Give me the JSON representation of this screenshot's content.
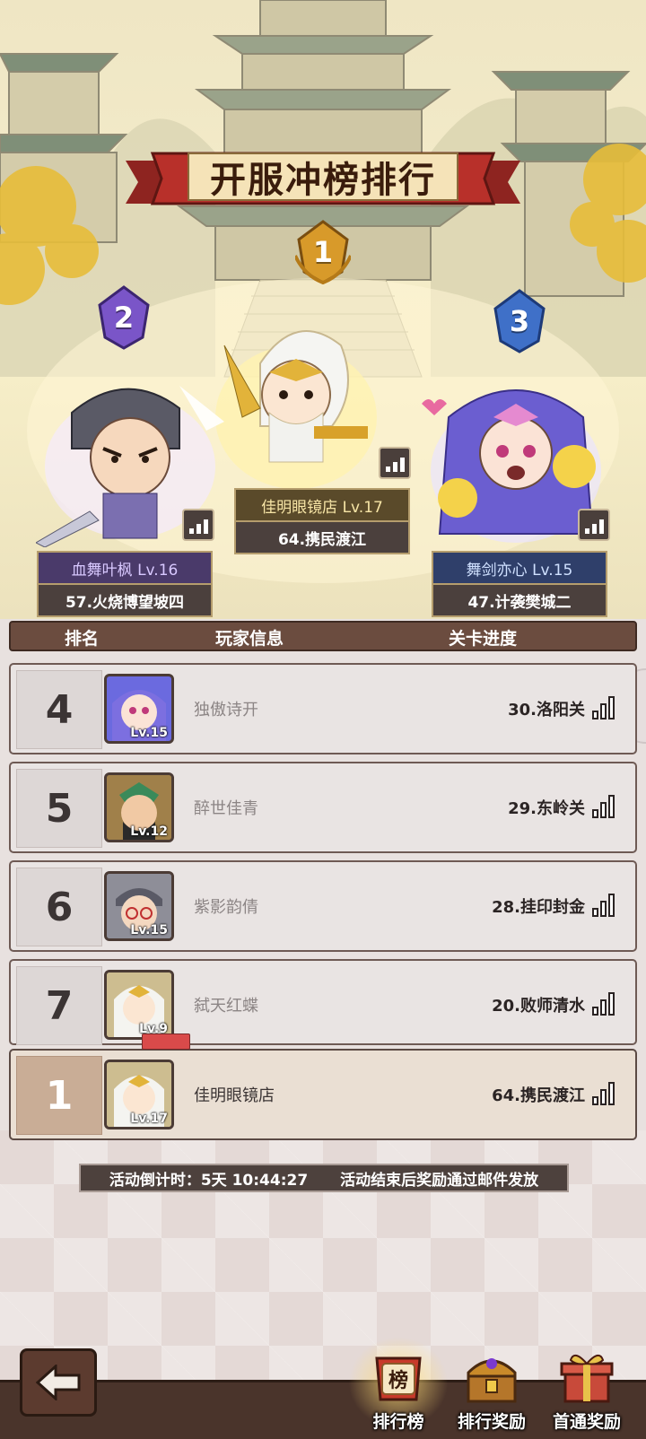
{
  "title": "开服冲榜排行",
  "podium": [
    {
      "rank": "1",
      "name": "佳明眼镜店 Lv.17",
      "stage": "64.携民渡江",
      "badge_color": "#d89a2a"
    },
    {
      "rank": "2",
      "name": "血舞叶枫 Lv.16",
      "stage": "57.火烧博望坡四",
      "badge_color": "#7a55c8"
    },
    {
      "rank": "3",
      "name": "舞剑亦心 Lv.15",
      "stage": "47.计袭樊城二",
      "badge_color": "#3f70c8"
    }
  ],
  "table": {
    "headers": {
      "rank": "排名",
      "player": "玩家信息",
      "progress": "关卡进度"
    },
    "rows": [
      {
        "rank": "4",
        "level": "Lv.15",
        "name": "独傲诗开",
        "progress": "30.洛阳关"
      },
      {
        "rank": "5",
        "level": "Lv.12",
        "name": "醉世佳青",
        "progress": "29.东岭关"
      },
      {
        "rank": "6",
        "level": "Lv.15",
        "name": "紫影韵倩",
        "progress": "28.挂印封金"
      },
      {
        "rank": "7",
        "level": "Lv.9",
        "name": "弑天红蝶",
        "progress": "20.败师清水"
      }
    ],
    "mine": {
      "rank": "1",
      "level": "Lv.17",
      "name": "佳明眼镜店",
      "progress": "64.携民渡江"
    }
  },
  "countdown": {
    "left": "活动倒计时：5天 10:44:27",
    "right": "活动结束后奖励通过邮件发放"
  },
  "tabs": [
    {
      "label": "排行榜",
      "icon": "ranking-scroll-icon"
    },
    {
      "label": "排行奖励",
      "icon": "treasure-chest-icon"
    },
    {
      "label": "首通奖励",
      "icon": "gift-box-icon"
    }
  ],
  "tab_icon_text": "榜",
  "colors": {
    "header_bg": "#6b4c3f",
    "mine_rank_bg": "#c9ad96",
    "bottom_bar": "#4a342b",
    "banner_red": "#b8302a"
  }
}
